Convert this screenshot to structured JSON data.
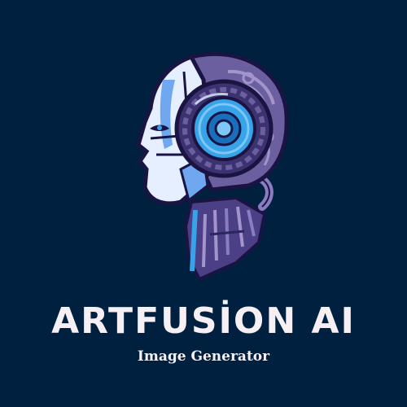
{
  "brand": {
    "name": "ARTFUSİON AI",
    "tagline": "Image Generator"
  },
  "logo": {
    "icon": "robot-head-icon"
  },
  "colors": {
    "background": "#00203f",
    "text": "#f6eff3",
    "face_light": "#e6efff",
    "face_blue": "#6fa8f0",
    "accent_blue": "#37a3e8",
    "outline": "#1a1442",
    "purple": "#6b5fa0",
    "purple_dark": "#3c3270",
    "purple_light": "#a494cc"
  }
}
